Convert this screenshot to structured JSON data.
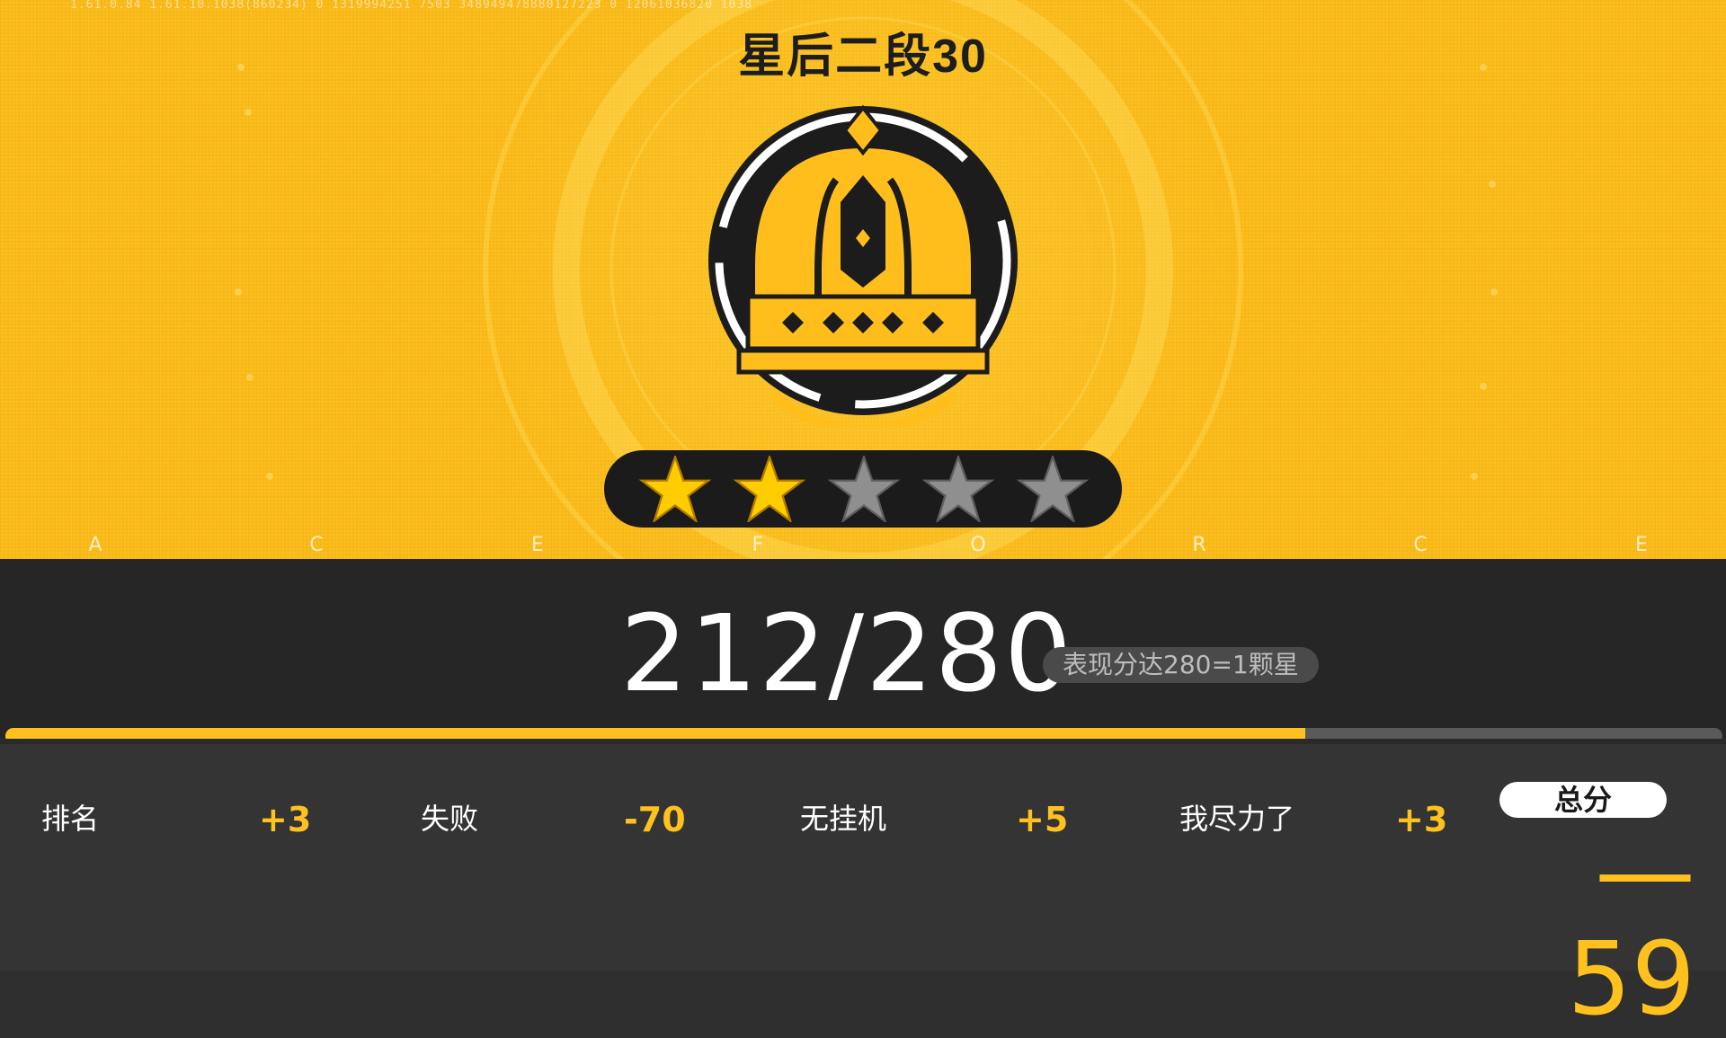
{
  "debug_info": "1.61.0.84  1.61.10.1038(860234)  0  1319994251 7503  348949478880127223 0  12061036820 1038",
  "rank": {
    "title": "星后二段30",
    "emblem": "queen-crown-emblem",
    "stars_filled": 2,
    "stars_total": 5
  },
  "letters": [
    "A",
    "C",
    "E",
    "F",
    "O",
    "R",
    "C",
    "E"
  ],
  "performance": {
    "score": "212/280",
    "hint": "表现分达280=1颗星",
    "progress_fraction": 0.757
  },
  "stats": [
    {
      "label": "排名",
      "value": "+3"
    },
    {
      "label": "失败",
      "value": "-70"
    },
    {
      "label": "无挂机",
      "value": "+5"
    },
    {
      "label": "我尽力了",
      "value": "+3"
    }
  ],
  "total": {
    "label": "总分",
    "value": "—59"
  },
  "colors": {
    "accent": "#ffc11e",
    "dark": "#1b1b1b",
    "star_filled": "#ffcc00",
    "star_empty": "#8f8f8f"
  }
}
